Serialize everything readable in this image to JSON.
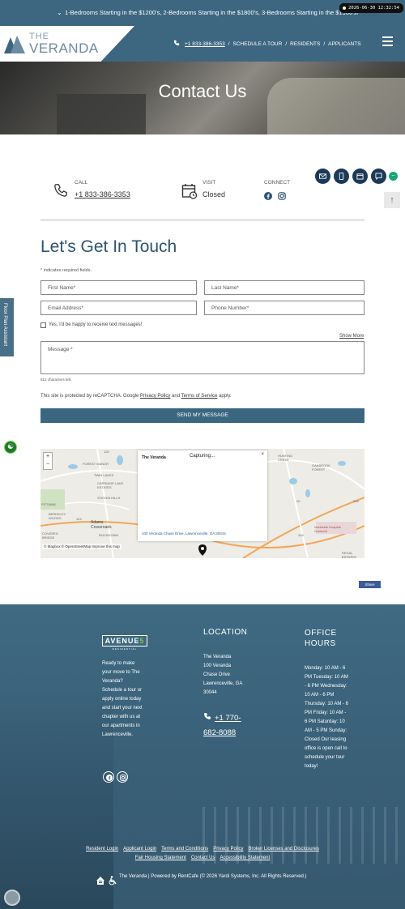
{
  "banner": {
    "text": "1-Bedrooms Starting in the $1200's, 2-Bedrooms Starting in the $1800's, 3-Bedrooms Starting in the $1900's!",
    "timestamp": "2026-06-30 12:32:54"
  },
  "header": {
    "logo_the": "THE",
    "logo_name": "VERANDA",
    "nav": {
      "phone": "+1 833-386-3353",
      "schedule": "SCHEDULE A TOUR",
      "residents": "RESIDENTS",
      "applicants": "APPLICANTS",
      "sep": "/"
    }
  },
  "hero": {
    "title": "Contact Us"
  },
  "contact_info": {
    "call_label": "CALL",
    "call_value": "+1 833-386-3353",
    "visit_label": "VISIT",
    "visit_value": "Closed",
    "connect_label": "CONNECT"
  },
  "side_tab": {
    "label": "Floor Plan Assistant"
  },
  "form": {
    "title": "Let's Get In Touch",
    "required_note": "* indicates required fields.",
    "first_name_placeholder": "First Name*",
    "last_name_placeholder": "Last Name*",
    "email_placeholder": "Email Address*",
    "phone_placeholder": "Phone Number*",
    "sms_label": "Yes, I'd be happy to receive text messages!",
    "show_more": "Show More",
    "message_placeholder": "Message *",
    "chars_left": "512 characters left.",
    "recaptcha_pre": "This site is protected by reCAPTCHA. Google ",
    "privacy_policy": "Privacy Policy",
    "recaptcha_and": " and ",
    "terms_of_service": "Terms of Service",
    "recaptcha_post": " apply.",
    "submit_label": "SEND MY MESSAGE"
  },
  "map": {
    "zoom_in": "+",
    "zoom_out": "−",
    "popup_title": "The Veranda",
    "popup_status": "Capturing...",
    "popup_close": "×",
    "popup_address": "100 Veranda Chase Drive, Lawrenceville, GA 30044",
    "attribution": "© Mapbox © OpenStreetMap Improve this map",
    "labels": {
      "forest_manor": "FOREST MANOR",
      "twin_lakes": "TWIN LAKES",
      "carriage_lake_estates": "CARRIAGE LAKE ESTATES",
      "steven_hills": "STEVEN HILLS",
      "pittman": "PITTMAN",
      "berkeley_woods": "BERKELEY WOODS",
      "adams_crossroads": "Adams Crossroads",
      "covered_bridge": "COVERED BRIDGE",
      "rockdown": "ROCKDOWN",
      "hunting_creek": "HUNTING CREEK",
      "oakbrook_forest": "OAKBROOK FOREST",
      "northside_hospital": "Northside Hospital Gwinnett",
      "regal_estates": "REGAL ESTATES",
      "route_120": "120",
      "route_316": "316",
      "route_316b": "316",
      "route_20": "20",
      "route_124": "124"
    }
  },
  "share": {
    "label": "Share"
  },
  "footer": {
    "brand": "AVENUE",
    "brand_num": "5",
    "brand_sub": "RESIDENTIAL",
    "blurb": "Ready to make your move to The Veranda? Schedule a tour or apply online today and start your next chapter with us at our apartments in Lawrenceville.",
    "location_heading": "LOCATION",
    "address_lines": [
      "The Veranda",
      "100 Veranda",
      "Chase Drive",
      "Lawrenceville, GA",
      "30044"
    ],
    "phone_line1": "+1 770-",
    "phone_line2": "682-8088",
    "hours_heading_1": "OFFICE",
    "hours_heading_2": "HOURS",
    "hours": "Monday: 10 AM - 6 PM Tuesday: 10 AM - 6 PM Wednesday: 10 AM - 6 PM Thursday: 10 AM - 6 PM Friday: 10 AM - 6 PM Saturday: 10 AM - 5 PM Sunday: Closed Our leasing office is open call to schedule your tour today!",
    "links": {
      "resident_login": "Resident Login",
      "applicant_login": "Applicant Login",
      "terms": "Terms and Conditions",
      "privacy": "Privacy Policy",
      "broker": "Broker Licenses and Disclosures",
      "fair_housing": "Fair Housing Statement",
      "contact": "Contact Us",
      "accessibility": "Accessibility Statement"
    },
    "copyright": "The Veranda | Powered by RentCafe (© 2026 Yardi Systems, Inc. All Rights Reserved.)"
  },
  "colors": {
    "brand": "#3d6680",
    "heading": "#2d5470",
    "fab": "#1b3a57",
    "accent_green": "#17a673"
  }
}
